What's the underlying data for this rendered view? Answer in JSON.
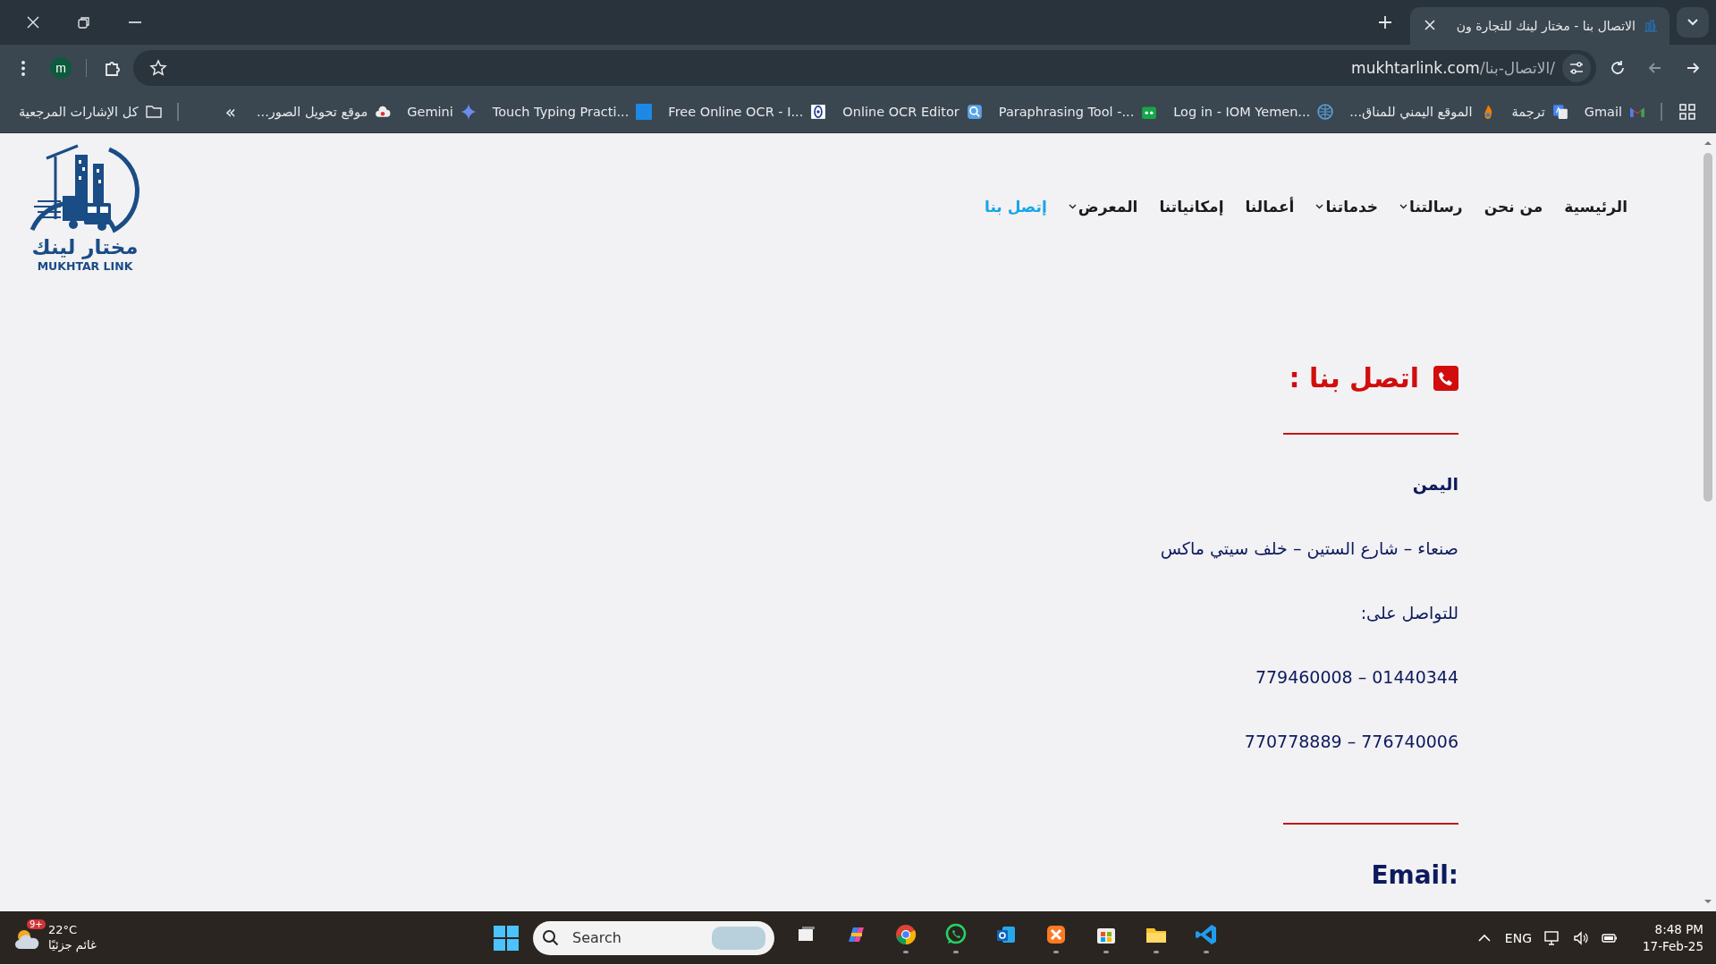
{
  "browser": {
    "tab": {
      "title": "الاتصال بنا - مختار لينك للتجارة ون",
      "selected": true
    },
    "address": {
      "host": "mukhtarlink.com",
      "path": "/الاتصال-بنا/"
    },
    "profile_initial": "m",
    "bookmarks": [
      {
        "label": "Gmail",
        "kind": "gmail"
      },
      {
        "label": "ترجمة",
        "kind": "translate"
      },
      {
        "label": "الموقع اليمني للمناق...",
        "kind": "flame"
      },
      {
        "label": "Log in - IOM Yemen...",
        "kind": "globe"
      },
      {
        "label": "Paraphrasing Tool -...",
        "kind": "robot"
      },
      {
        "label": "Online OCR Editor",
        "kind": "ocr"
      },
      {
        "label": "Free Online OCR - I...",
        "kind": "eye"
      },
      {
        "label": "Touch Typing Practi...",
        "kind": "ts"
      },
      {
        "label": "Gemini",
        "kind": "sparkle"
      },
      {
        "label": "موقع تحويل الصور...",
        "kind": "cloud"
      }
    ],
    "more_bookmarks": "»",
    "all_bookmarks": "كل الإشارات المرجعية"
  },
  "site": {
    "logo": {
      "name_ar": "مختار لينك",
      "name_en": "MUKHTAR LINK"
    },
    "nav": [
      {
        "label": "الرئيسية",
        "selected": false,
        "submenu": false
      },
      {
        "label": "من نحن",
        "selected": false,
        "submenu": false
      },
      {
        "label": "رسالتنا",
        "selected": false,
        "submenu": true
      },
      {
        "label": "خدماتنا",
        "selected": false,
        "submenu": true
      },
      {
        "label": "أعمالنا",
        "selected": false,
        "submenu": false
      },
      {
        "label": "إمكانياتنا",
        "selected": false,
        "submenu": false
      },
      {
        "label": "المعرض",
        "selected": false,
        "submenu": true
      },
      {
        "label": "إتصل بنا",
        "selected": true,
        "submenu": false
      }
    ],
    "contact": {
      "heading": "اتصل بنا :",
      "country": "اليمن",
      "address": "صنعاء – شارع الستين – خلف سيتي ماكس",
      "reach_label": "للتواصل على:",
      "phones": [
        "779460008 – 01440344",
        "770778889 – 776740006"
      ],
      "email_heading": "Email:"
    }
  },
  "taskbar": {
    "weather": {
      "temperature": "22°C",
      "condition": "غائم جزئيًا",
      "badge": "9+"
    },
    "search": {
      "placeholder": "Search"
    },
    "apps": [
      {
        "kind": "taskview",
        "running": false
      },
      {
        "kind": "copilot",
        "running": false
      },
      {
        "kind": "chrome",
        "running": true
      },
      {
        "kind": "whatsapp",
        "running": true
      },
      {
        "kind": "outlook",
        "running": false
      },
      {
        "kind": "xampp",
        "running": true
      },
      {
        "kind": "store",
        "running": true
      },
      {
        "kind": "files",
        "running": true
      },
      {
        "kind": "vscode",
        "running": true
      }
    ],
    "language": "ENG",
    "time": "8:48 PM",
    "date": "17-Feb-25"
  }
}
